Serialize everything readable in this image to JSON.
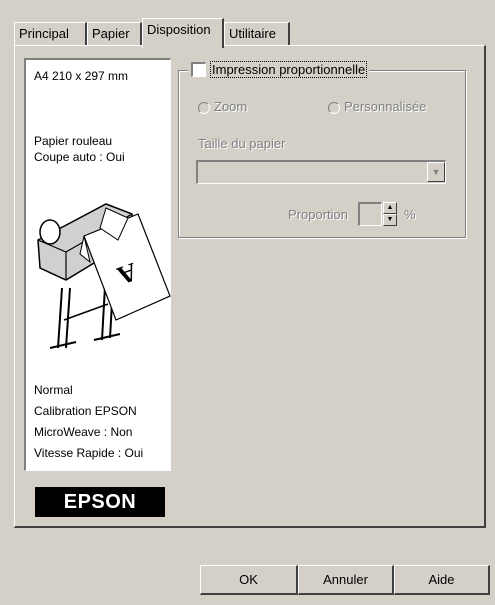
{
  "tabs": [
    {
      "label": "Principal"
    },
    {
      "label": "Papier"
    },
    {
      "label": "Disposition"
    },
    {
      "label": "Utilitaire"
    }
  ],
  "preview": {
    "paper_size": "A4 210 x 297 mm",
    "paper_source": "Papier rouleau",
    "auto_cut": "Coupe auto : Oui",
    "settings": [
      "Normal",
      "Calibration EPSON",
      "MicroWeave : Non",
      "Vitesse Rapide : Oui"
    ],
    "printer_sheet_letter": "A"
  },
  "logo": {
    "text": "EPSON"
  },
  "proportional": {
    "label": "Impression proportionnelle",
    "checked": false,
    "zoom_label": "Zoom",
    "custom_label": "Personnalisée",
    "paper_size_label": "Taille du papier",
    "paper_size_value": "",
    "proportion_label": "Proportion",
    "proportion_value": "",
    "percent_sign": "%"
  },
  "buttons": {
    "ok": "OK",
    "cancel": "Annuler",
    "help": "Aide"
  },
  "colors": {
    "dialog_bg": "#d4d0c8",
    "disabled_text": "#808080"
  }
}
